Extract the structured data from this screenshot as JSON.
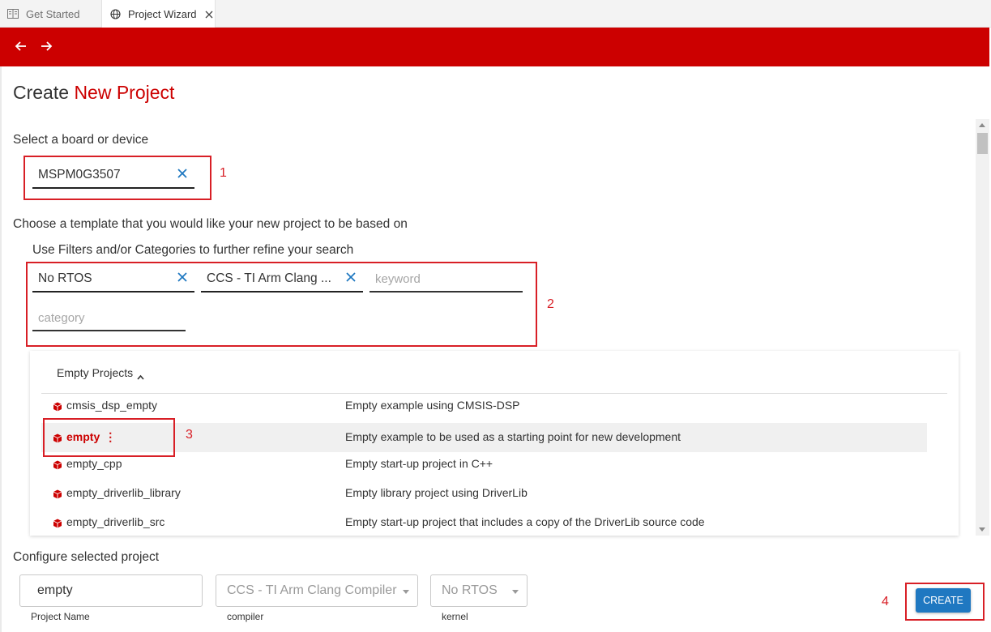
{
  "tabs": [
    {
      "label": "Get Started",
      "icon": "book-icon"
    },
    {
      "label": "Project Wizard",
      "icon": "globe-icon"
    }
  ],
  "colors": {
    "brand": "#cc0000",
    "annotation": "#d81f26",
    "primary_button": "#1f78c1"
  },
  "title": {
    "prefix": "Create",
    "accent": "New Project"
  },
  "device": {
    "label": "Select a board or device",
    "value": "MSPM0G3507"
  },
  "template": {
    "label": "Choose a template that you would like your new project to be based on",
    "filters_label": "Use Filters and/or Categories to further refine your search",
    "filters": [
      {
        "value": "No RTOS"
      },
      {
        "value": "CCS - TI Arm Clang ..."
      }
    ],
    "keyword_placeholder": "keyword",
    "category_placeholder": "category"
  },
  "category": {
    "name": "Empty Projects",
    "rows": [
      {
        "name": "cmsis_dsp_empty",
        "desc": "Empty example using CMSIS-DSP"
      },
      {
        "name": "empty",
        "desc": "Empty example to be used as a starting point for new development",
        "selected": true
      },
      {
        "name": "empty_cpp",
        "desc": "Empty start-up project in C++"
      },
      {
        "name": "empty_driverlib_library",
        "desc": "Empty library project using DriverLib"
      },
      {
        "name": "empty_driverlib_src",
        "desc": "Empty start-up project that includes a copy of the DriverLib source code"
      }
    ]
  },
  "configure": {
    "label": "Configure selected project",
    "project_name": "empty",
    "project_name_label": "Project Name",
    "compiler": "CCS - TI Arm Clang Compiler",
    "compiler_label": "compiler",
    "kernel": "No RTOS",
    "kernel_label": "kernel"
  },
  "create_label": "CREATE",
  "steps": [
    "1",
    "2",
    "3",
    "4"
  ]
}
